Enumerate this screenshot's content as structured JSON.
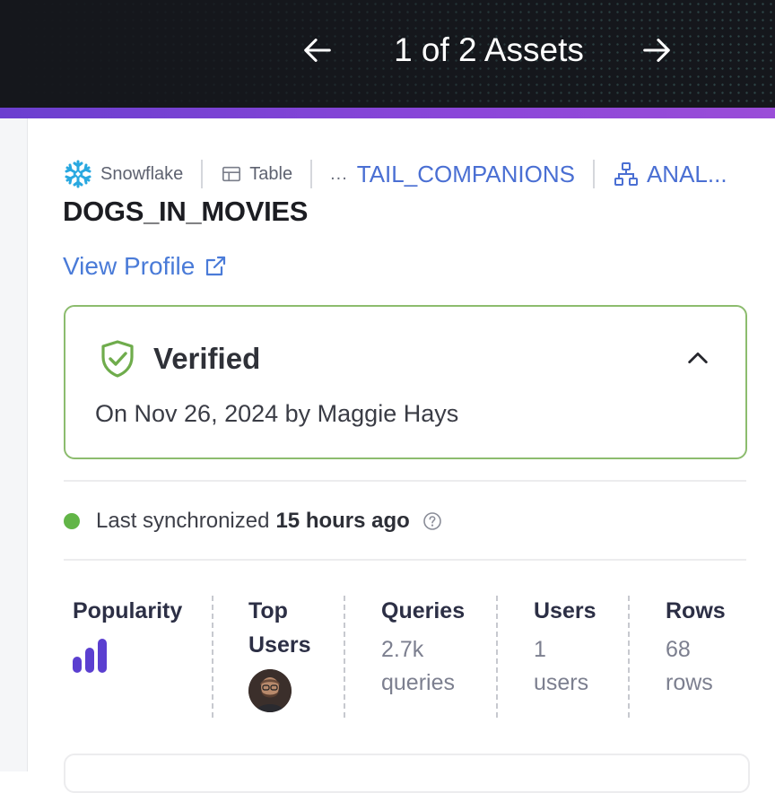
{
  "header": {
    "counter": "1 of 2 Assets",
    "prev_icon": "arrow-left-icon",
    "next_icon": "arrow-right-icon",
    "accent_color": "#8b46d9"
  },
  "breadcrumbs": {
    "platform": "Snowflake",
    "type": "Table",
    "ellipsis": "...",
    "container": "TAIL_COMPANIONS",
    "domain": "ANAL..."
  },
  "asset": {
    "title": "DOGS_IN_MOVIES",
    "view_profile": "View Profile"
  },
  "verified": {
    "title": "Verified",
    "subtitle": "On Nov 26, 2024 by Maggie Hays",
    "border_color": "#8cbc6e"
  },
  "sync": {
    "prefix": "Last synchronized",
    "value": "15 hours ago",
    "status_color": "#62b547"
  },
  "stats": {
    "popularity": {
      "label": "Popularity",
      "level": 3,
      "max": 3
    },
    "top_users": {
      "label_line1": "Top",
      "label_line2": "Users"
    },
    "queries": {
      "label": "Queries",
      "value": "2.7k",
      "unit": "queries"
    },
    "users": {
      "label": "Users",
      "value": "1",
      "unit": "users"
    },
    "rows": {
      "label": "Rows",
      "value": "68",
      "unit": "rows"
    }
  }
}
